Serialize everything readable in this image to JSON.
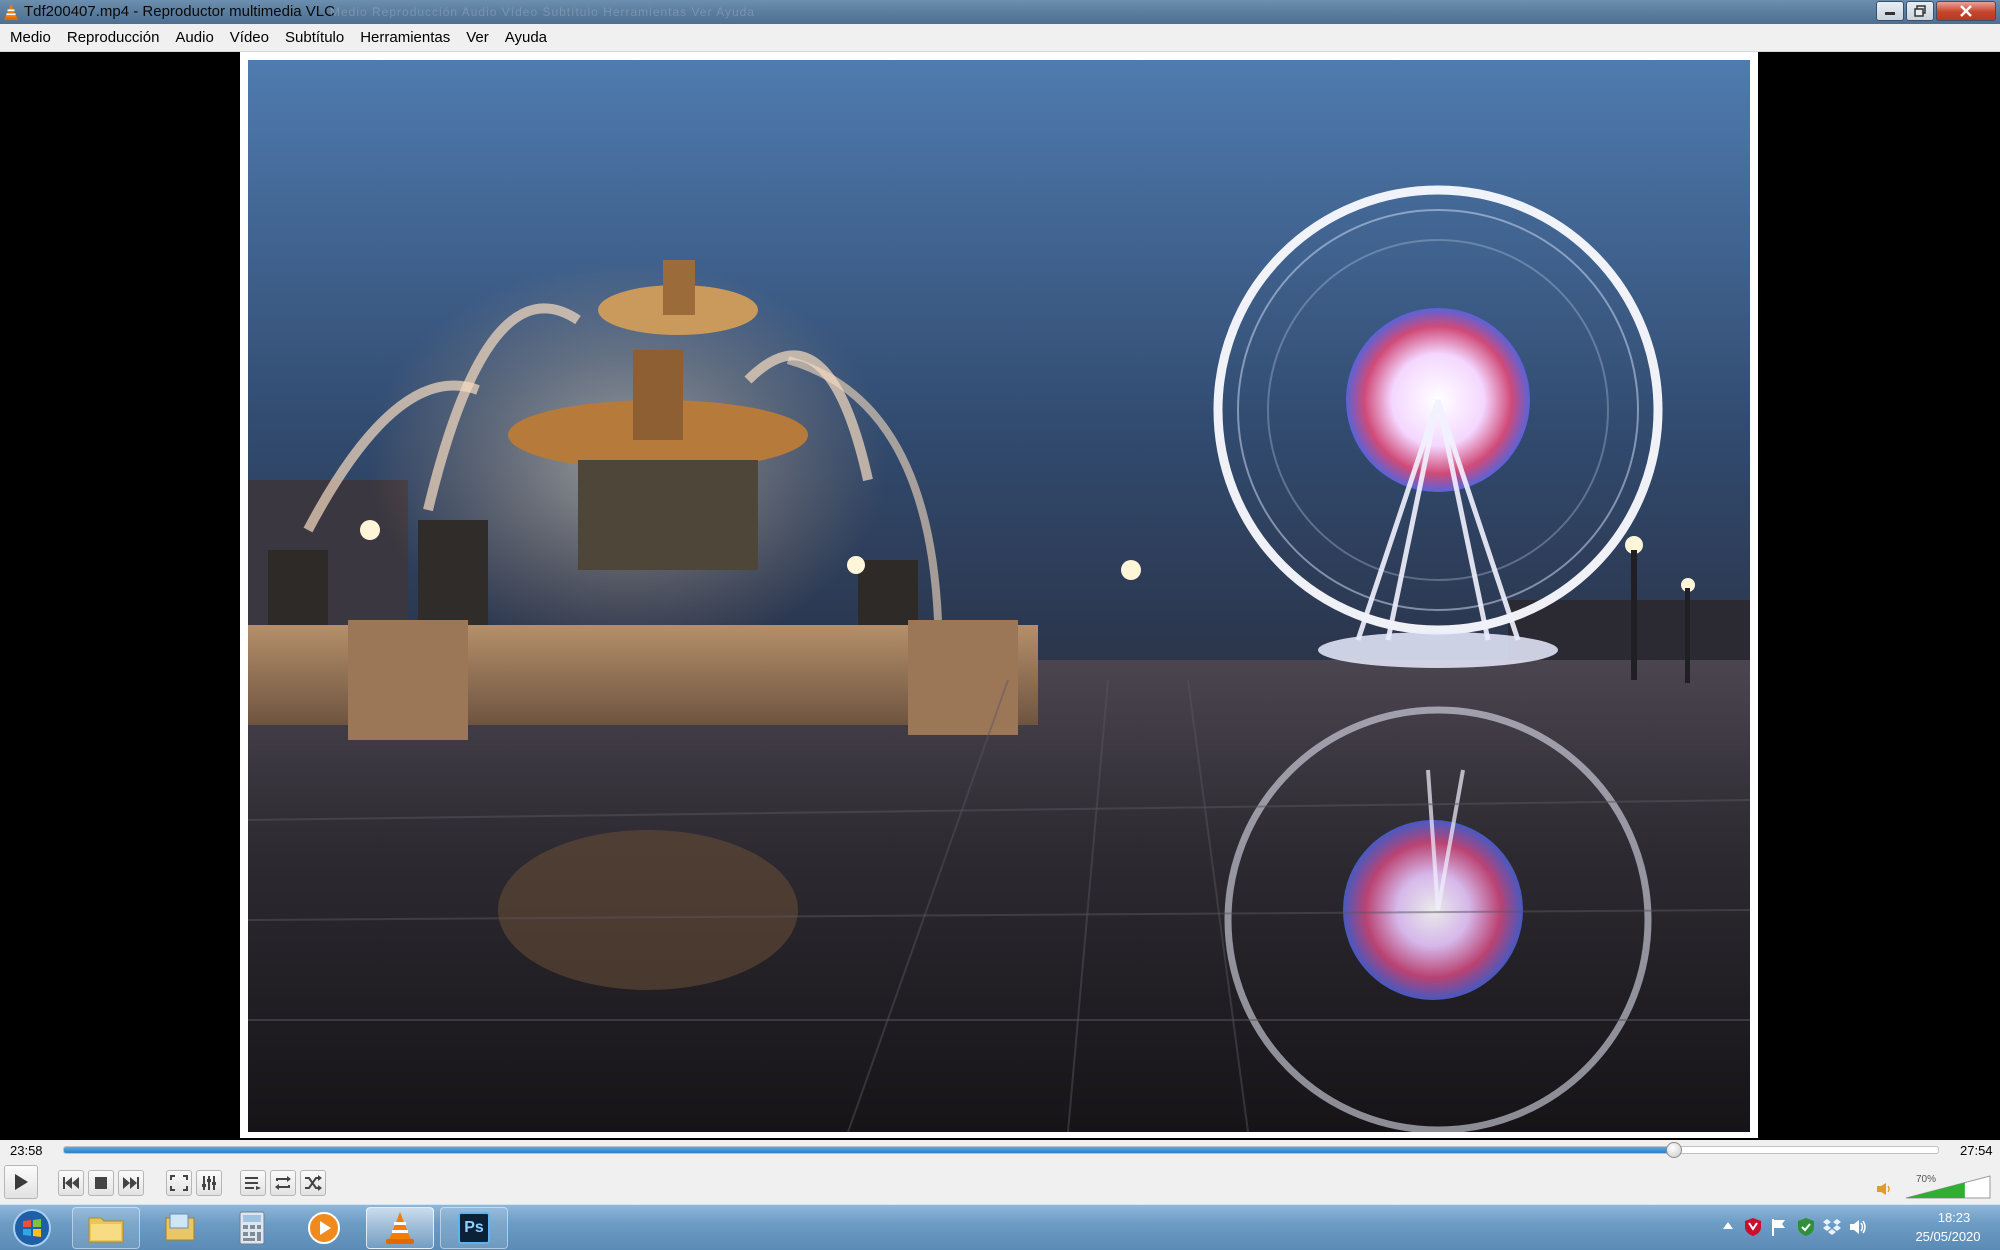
{
  "window": {
    "title": "Tdf200407.mp4 - Reproductor multimedia VLC",
    "ghost_menu": "Medio   Reproducción   Audio   Vídeo   Subtítulo   Herramientas   Ver   Ayuda"
  },
  "menu": [
    "Medio",
    "Reproducción",
    "Audio",
    "Vídeo",
    "Subtítulo",
    "Herramientas",
    "Ver",
    "Ayuda"
  ],
  "player": {
    "time_elapsed": "23:58",
    "time_total": "27:54",
    "progress_fraction": 0.859,
    "volume_percent": "70%",
    "volume_fraction": 0.7
  },
  "taskbar": {
    "clock_time": "18:23",
    "clock_date": "25/05/2020",
    "apps": [
      "start-orb",
      "file-explorer",
      "explorer-folder",
      "calculator",
      "media-player",
      "vlc",
      "photoshop"
    ],
    "photoshop_label": "Ps"
  },
  "colors": {
    "vlc_orange": "#f57c00",
    "seek_blue": "#2e7fc4",
    "taskbar_blue": "#6d9cc4"
  }
}
